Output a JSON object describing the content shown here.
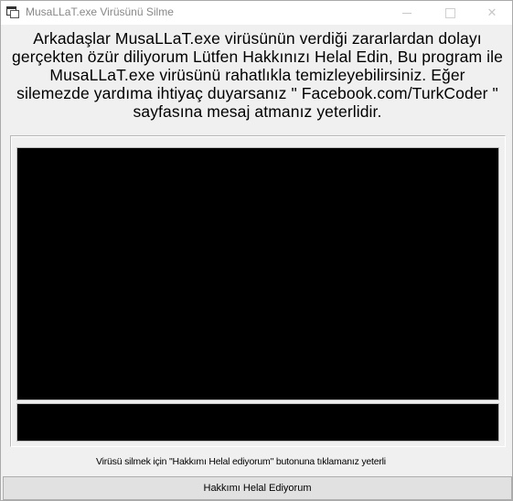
{
  "window": {
    "title": "MusaLLaT.exe Virüsünü Silme",
    "icon": "app-window-icon",
    "controls": {
      "minimize": "minimize-icon",
      "maximize": "maximize-icon",
      "close": "✕"
    }
  },
  "message": {
    "lines": [
      "Arkadaşlar MusaLLaT.exe virüsünün verdiği zararlardan dolayı",
      "gerçekten özür diliyorum Lütfen Hakkınızı Helal Edin,  Bu program ile",
      "MusaLLaT.exe virüsünü rahatlıkla temizleyebilirsiniz.  Eğer",
      "silemezde yardıma ihtiyaç duyarsanız \" Facebook.com/TurkCoder \"",
      "sayfasına mesaj atmanız yeterlidir."
    ]
  },
  "hint": "Virüsü silmek için \"Hakkımı Helal ediyorum\" butonuna tıklamanız yeterli",
  "button": {
    "label": "Hakkımı Helal Ediyorum"
  },
  "colors": {
    "screen_bg": "#000000",
    "window_bg": "#f0f0f0"
  }
}
